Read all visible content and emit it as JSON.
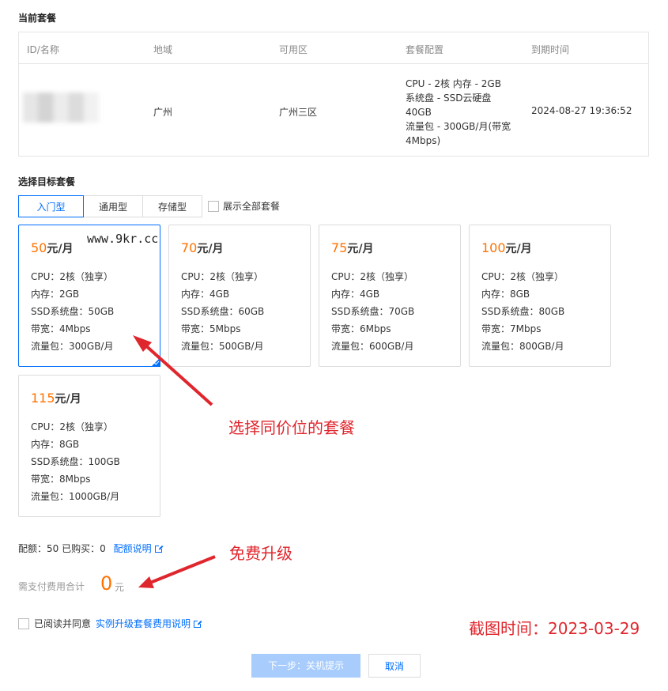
{
  "current": {
    "title": "当前套餐",
    "headers": [
      "ID/名称",
      "地域",
      "可用区",
      "套餐配置",
      "到期时间"
    ],
    "region": "广州",
    "zone": "广州三区",
    "config_lines": [
      "CPU - 2核 内存 - 2GB",
      "系统盘 - SSD云硬盘",
      "40GB",
      "流量包 - 300GB/月(带宽",
      "4Mbps)"
    ],
    "expire": "2024-08-27 19:36:52"
  },
  "target": {
    "title": "选择目标套餐",
    "tabs": [
      "入门型",
      "通用型",
      "存储型"
    ],
    "show_all_label": "展示全部套餐"
  },
  "watermark": "www.9kr.cc",
  "plans": [
    {
      "price": "50",
      "unit": "元/月",
      "cpu": "CPU：2核（独享）",
      "mem": "内存：2GB",
      "disk": "SSD系统盘：50GB",
      "bw": "带宽：4Mbps",
      "traffic": "流量包：300GB/月"
    },
    {
      "price": "70",
      "unit": "元/月",
      "cpu": "CPU：2核（独享）",
      "mem": "内存：4GB",
      "disk": "SSD系统盘：60GB",
      "bw": "带宽：5Mbps",
      "traffic": "流量包：500GB/月"
    },
    {
      "price": "75",
      "unit": "元/月",
      "cpu": "CPU：2核（独享）",
      "mem": "内存：4GB",
      "disk": "SSD系统盘：70GB",
      "bw": "带宽：6Mbps",
      "traffic": "流量包：600GB/月"
    },
    {
      "price": "100",
      "unit": "元/月",
      "cpu": "CPU：2核（独享）",
      "mem": "内存：8GB",
      "disk": "SSD系统盘：80GB",
      "bw": "带宽：7Mbps",
      "traffic": "流量包：800GB/月"
    },
    {
      "price": "115",
      "unit": "元/月",
      "cpu": "CPU：2核（独享）",
      "mem": "内存：8GB",
      "disk": "SSD系统盘：100GB",
      "bw": "带宽：8Mbps",
      "traffic": "流量包：1000GB/月"
    }
  ],
  "annotations": {
    "same_price": "选择同价位的套餐",
    "free_upgrade": "免费升级",
    "screenshot_time": "截图时间：2023-03-29"
  },
  "quota": {
    "text": "配额：50  已购买：0",
    "link": "配额说明"
  },
  "cost": {
    "label": "需支付费用合计",
    "value": "0",
    "unit": "元"
  },
  "agree": {
    "prefix": "已阅读并同意",
    "link": "实例升级套餐费用说明"
  },
  "buttons": {
    "next": "下一步：关机提示",
    "cancel": "取消"
  },
  "colors": {
    "accent": "#006eff",
    "price": "#ff7200",
    "annotation": "#e0262d"
  }
}
